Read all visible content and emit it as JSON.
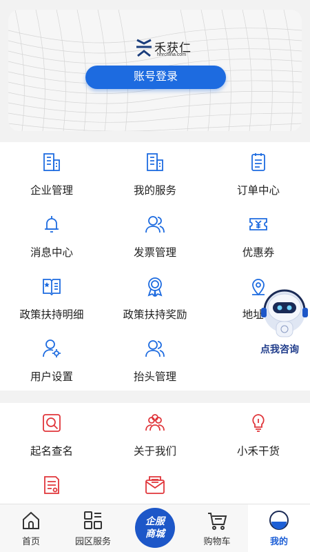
{
  "header": {
    "brand_title": "禾获仁",
    "brand_url": "hhrchina.com",
    "login_button": "账号登录"
  },
  "colors": {
    "accent": "#1d6be0",
    "blue_icon": "#1d6be0",
    "red_icon": "#e0353a",
    "robot_text": "#1e3b8a"
  },
  "services": [
    {
      "label": "企业管理",
      "icon": "building-icon"
    },
    {
      "label": "我的服务",
      "icon": "building-icon"
    },
    {
      "label": "订单中心",
      "icon": "clipboard-icon"
    },
    {
      "label": "消息中心",
      "icon": "bell-icon"
    },
    {
      "label": "发票管理",
      "icon": "users-icon"
    },
    {
      "label": "优惠券",
      "icon": "coupon-icon"
    },
    {
      "label": "政策扶持明细",
      "icon": "book-icon"
    },
    {
      "label": "政策扶持奖励",
      "icon": "medal-icon"
    },
    {
      "label": "地址管",
      "icon": "location-pin-icon"
    },
    {
      "label": "用户设置",
      "icon": "user-settings-icon"
    },
    {
      "label": "抬头管理",
      "icon": "users-icon"
    }
  ],
  "tools": [
    {
      "label": "起名查名",
      "icon": "search-name-icon"
    },
    {
      "label": "关于我们",
      "icon": "users-icon"
    },
    {
      "label": "小禾干货",
      "icon": "lightbulb-icon"
    },
    {
      "label": "",
      "icon": "document-icon"
    },
    {
      "label": "",
      "icon": "mail-icon"
    }
  ],
  "robot": {
    "label": "点我咨询"
  },
  "tabbar": {
    "items": [
      {
        "label": "首页",
        "icon": "home-icon"
      },
      {
        "label": "园区服务",
        "icon": "grid-icon"
      },
      {
        "label": "企服商城",
        "icon": "store-badge"
      },
      {
        "label": "购物车",
        "icon": "cart-icon"
      },
      {
        "label": "我的",
        "icon": "profile-icon"
      }
    ],
    "center_line1": "企服",
    "center_line2": "商城",
    "active": "我的"
  }
}
